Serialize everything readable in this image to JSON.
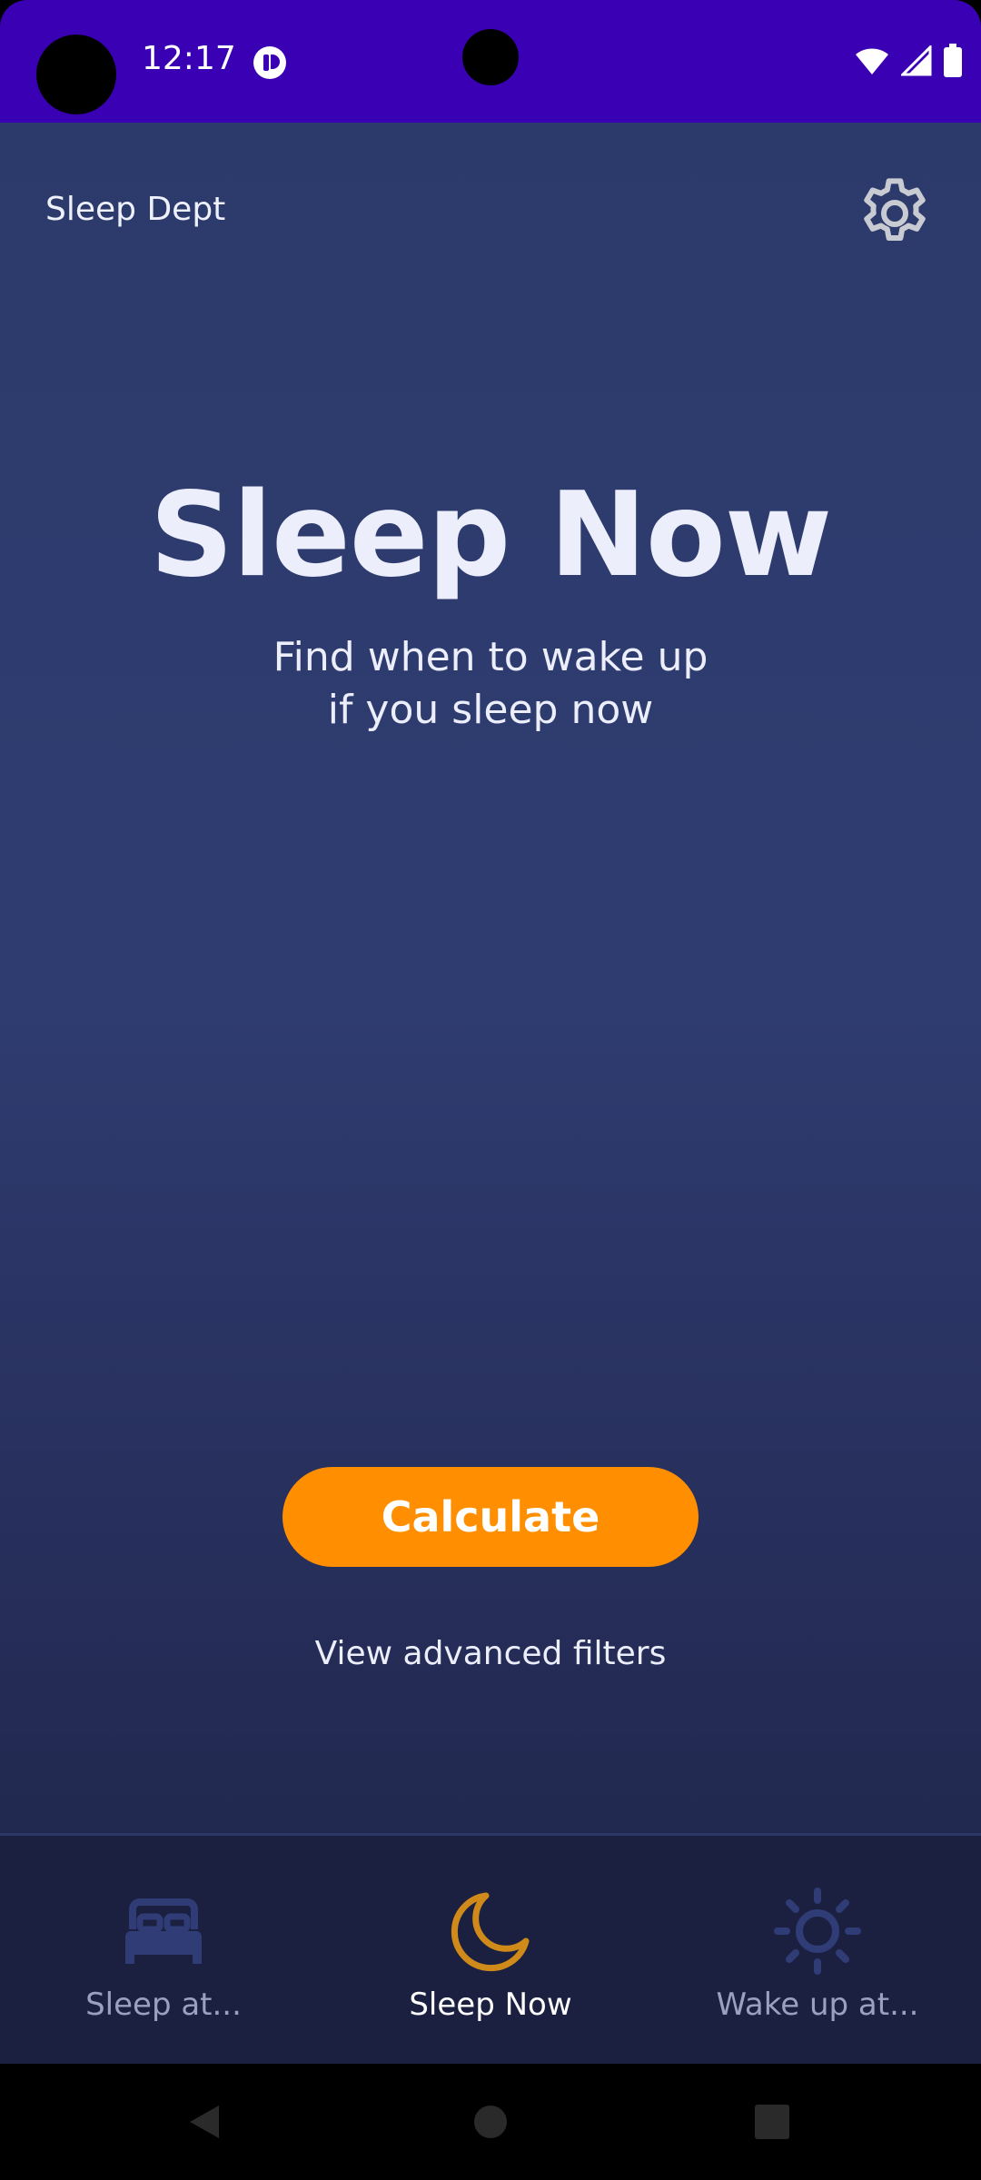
{
  "status_bar": {
    "time": "12:17"
  },
  "app_bar": {
    "title": "Sleep Dept",
    "settings_icon": "gear-icon"
  },
  "main": {
    "headline": "Sleep Now",
    "subtitle_line1": "Find when to wake up",
    "subtitle_line2": "if you sleep now",
    "calculate_label": "Calculate",
    "advanced_filters_label": "View advanced filters"
  },
  "bottom_nav": {
    "items": [
      {
        "label": "Sleep at...",
        "icon": "bed-icon",
        "active": false
      },
      {
        "label": "Sleep Now",
        "icon": "moon-icon",
        "active": true
      },
      {
        "label": "Wake up at...",
        "icon": "sun-icon",
        "active": false
      }
    ]
  },
  "colors": {
    "status_bar": "#3a00b3",
    "accent": "#ff8f00",
    "moon_active": "#d08a1a",
    "inactive_icon": "#2f3c75"
  }
}
